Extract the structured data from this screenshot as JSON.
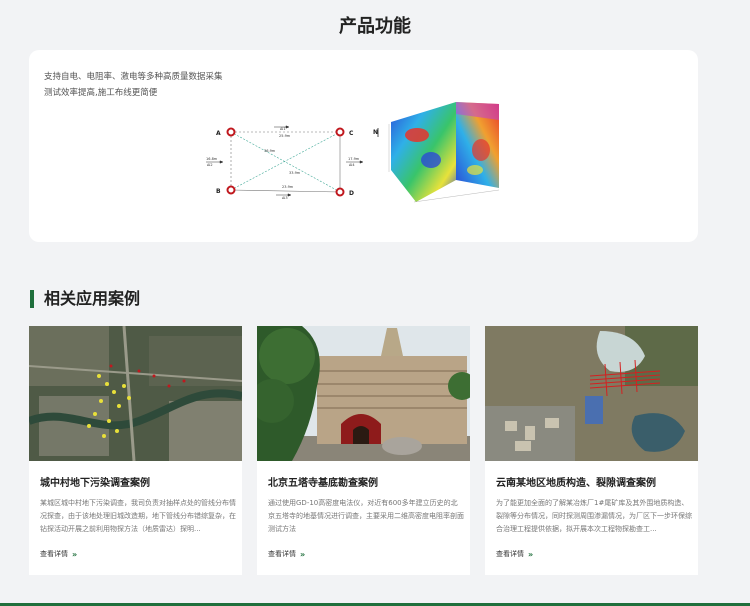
{
  "product": {
    "title": "产品功能",
    "features": [
      "支持自电、电阻率、激电等多种高质量数据采集",
      "测试效率提高,施工布线更简便"
    ],
    "diagram": {
      "points": [
        "A",
        "B",
        "C",
        "D"
      ],
      "labels": {
        "ac": "25.9m",
        "ac2": "Δl1",
        "bd": "23.9m",
        "bd2": "Δl3",
        "diag1": "36.9m",
        "diag2": "33.9m",
        "left": "16.8m",
        "left2": "Δl2",
        "right": "17.9m",
        "right2": "Δl4",
        "north": "N"
      }
    }
  },
  "cases": {
    "heading": "相关应用案例",
    "items": [
      {
        "title": "城中村地下污染调查案例",
        "desc": "某城区城中村地下污染调查，我司负责对抽样点处的管线分布情况探查，由于该地处理旧城改造期，地下管线分布错综复杂，在钻探活动开展之前利用物探方法（地质雷达）探明...",
        "more": "查看详情"
      },
      {
        "title": "北京五塔寺基底勘查案例",
        "desc": "通过使用GD-10高密度电法仪，对近有600多年建立历史的北京五塔寺的地基情况进行调查，主要采用二维高密度电阻率剖面测试方法",
        "more": "查看详情"
      },
      {
        "title": "云南某地区地质构造、裂隙调查案例",
        "desc": "为了能更加全面的了解某冶炼厂1#尾矿库及其外围地质构造、裂隙等分布情况，同时探测周围渗漏情况，为厂区下一步环保综合治理工程提供依据，拟开展本次工程物探勘查工...",
        "more": "查看详情"
      }
    ]
  },
  "colors": {
    "accent": "#1f6f3c",
    "background": "#f2f3f5"
  }
}
